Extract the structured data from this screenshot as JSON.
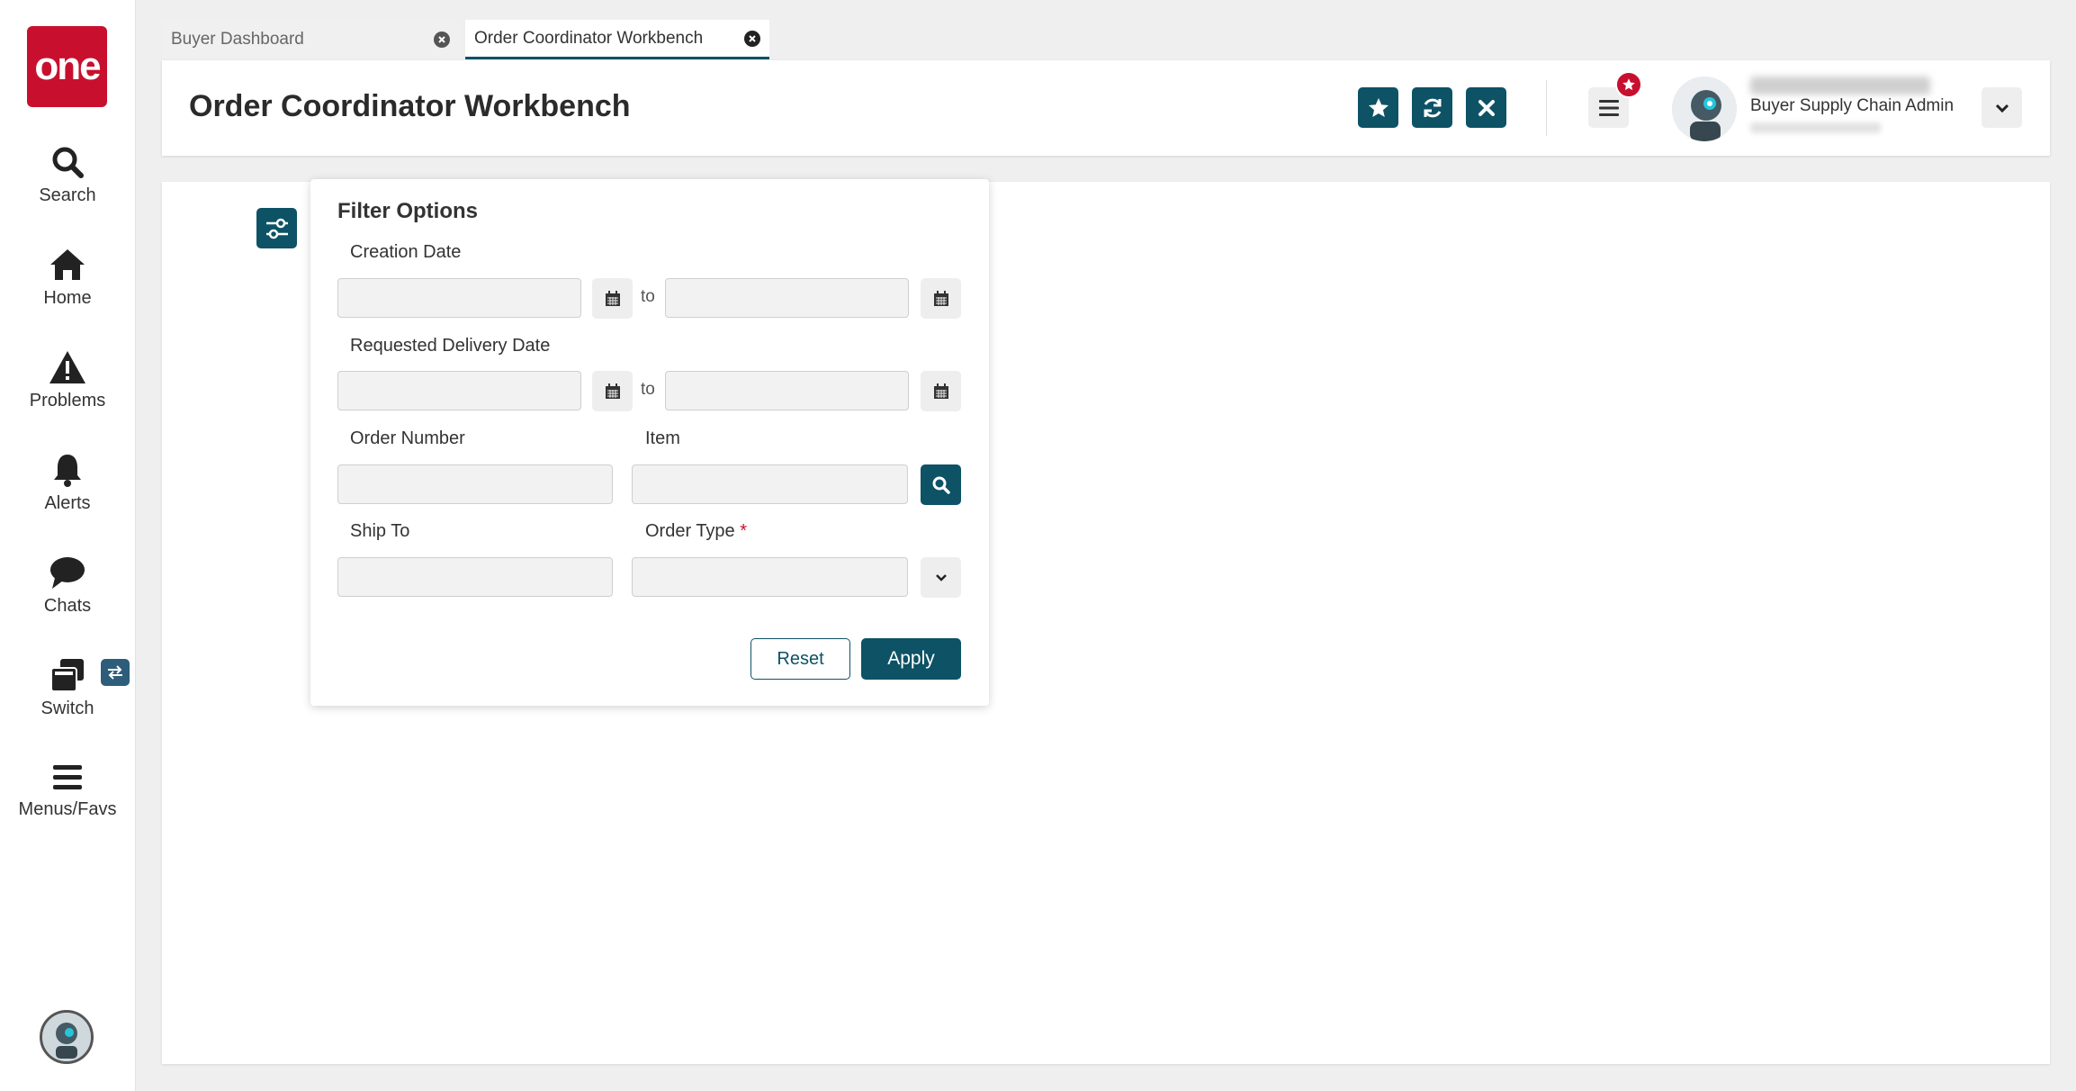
{
  "app": {
    "logo_text": "one"
  },
  "sidebar": {
    "items": [
      {
        "label": "Search",
        "icon": "search-icon"
      },
      {
        "label": "Home",
        "icon": "home-icon"
      },
      {
        "label": "Problems",
        "icon": "warning-icon"
      },
      {
        "label": "Alerts",
        "icon": "bell-icon"
      },
      {
        "label": "Chats",
        "icon": "chat-icon"
      },
      {
        "label": "Switch",
        "icon": "switch-icon"
      },
      {
        "label": "Menus/Favs",
        "icon": "menu-icon"
      }
    ]
  },
  "tabs": [
    {
      "label": "Buyer Dashboard",
      "active": false
    },
    {
      "label": "Order Coordinator Workbench",
      "active": true
    }
  ],
  "header": {
    "title": "Order Coordinator Workbench",
    "user": {
      "role": "Buyer Supply Chain Admin"
    }
  },
  "filter": {
    "title": "Filter Options",
    "creation_date_label": "Creation Date",
    "requested_delivery_date_label": "Requested Delivery Date",
    "to_label": "to",
    "order_number_label": "Order Number",
    "item_label": "Item",
    "ship_to_label": "Ship To",
    "order_type_label": "Order Type",
    "required_marker": "*",
    "reset_label": "Reset",
    "apply_label": "Apply"
  },
  "colors": {
    "brand_red": "#c8102e",
    "accent_teal": "#0d5265"
  }
}
